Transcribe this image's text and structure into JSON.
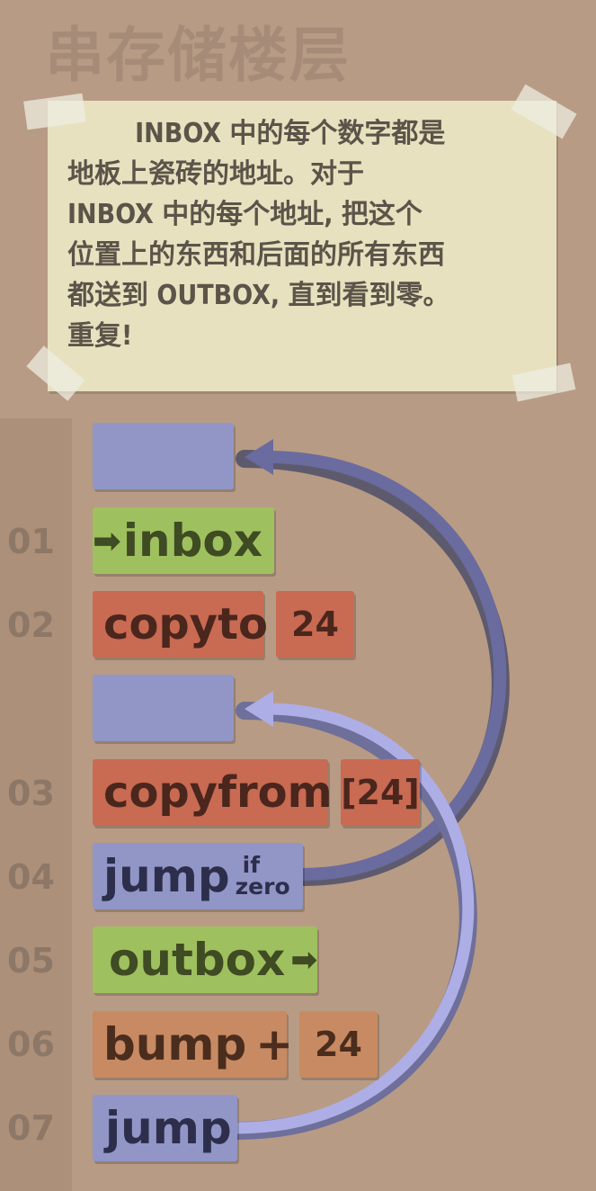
{
  "title": "串存储楼层",
  "note": {
    "text": "        INBOX 中的每个数字都是\n地板上瓷砖的地址。对于\nINBOX 中的每个地址, 把这个\n位置上的东西和后面的所有东西\n都送到 OUTBOX, 直到看到零。\n重复!"
  },
  "program": {
    "line_numbers": [
      "01",
      "02",
      "03",
      "04",
      "05",
      "06",
      "07"
    ],
    "commands": {
      "inbox": "inbox",
      "copyto": "copyto",
      "copyto_arg": "24",
      "copyfrom": "copyfrom",
      "copyfrom_arg": "[24]",
      "jumpz": "jump",
      "jumpz_if": "if",
      "jumpz_zero": "zero",
      "outbox": "outbox",
      "bump": "bump",
      "bump_plus": "+",
      "bump_arg": "24",
      "jump": "jump"
    }
  },
  "colors": {
    "background": "#b89b85",
    "inbox_outbox": "#9fc05e",
    "copy": "#c96a52",
    "bump": "#c88a62",
    "jump": "#9196c7",
    "jump_arrow_dark": "#6a6b9e",
    "jump_arrow_light": "#aeaee6"
  }
}
